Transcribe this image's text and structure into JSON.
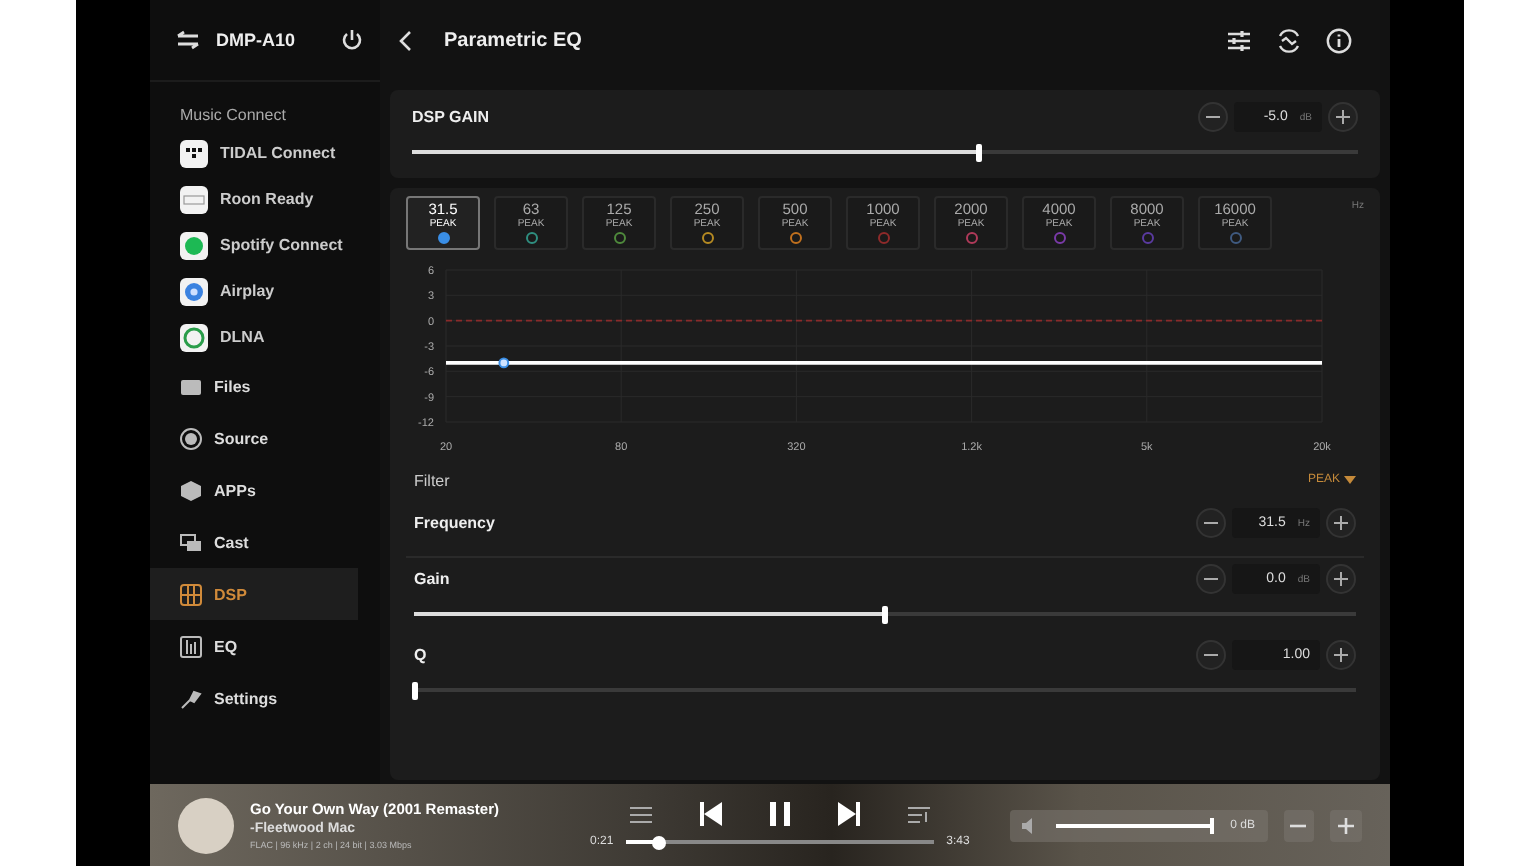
{
  "sidebar": {
    "device": "DMP-A10",
    "section_title": "Music Connect",
    "connect_items": [
      {
        "label": "TIDAL Connect",
        "kind": "tidal"
      },
      {
        "label": "Roon Ready",
        "kind": "roon"
      },
      {
        "label": "Spotify Connect",
        "kind": "spotify"
      },
      {
        "label": "Airplay",
        "kind": "airplay"
      },
      {
        "label": "DLNA",
        "kind": "dlna"
      }
    ],
    "items": [
      {
        "label": "Files",
        "kind": "files",
        "selected": false
      },
      {
        "label": "Source",
        "kind": "source",
        "selected": false
      },
      {
        "label": "APPs",
        "kind": "apps",
        "selected": false
      },
      {
        "label": "Cast",
        "kind": "cast",
        "selected": false
      },
      {
        "label": "DSP",
        "kind": "dsp",
        "selected": true
      },
      {
        "label": "EQ",
        "kind": "eq",
        "selected": false
      },
      {
        "label": "Settings",
        "kind": "settings",
        "selected": false
      }
    ]
  },
  "header": {
    "title": "Parametric EQ"
  },
  "dsp_gain": {
    "label": "DSP GAIN",
    "value": "-5.0",
    "unit": "dB",
    "level": 0.6
  },
  "bands": [
    {
      "freq": "31.5",
      "type": "PEAK",
      "color": "#3a8ee6",
      "selected": true
    },
    {
      "freq": "63",
      "type": "PEAK",
      "color": "#2f8f80",
      "selected": false
    },
    {
      "freq": "125",
      "type": "PEAK",
      "color": "#4f8a3c",
      "selected": false
    },
    {
      "freq": "250",
      "type": "PEAK",
      "color": "#b58a22",
      "selected": false
    },
    {
      "freq": "500",
      "type": "PEAK",
      "color": "#c0701e",
      "selected": false
    },
    {
      "freq": "1000",
      "type": "PEAK",
      "color": "#8e2a2a",
      "selected": false
    },
    {
      "freq": "2000",
      "type": "PEAK",
      "color": "#b03a5a",
      "selected": false
    },
    {
      "freq": "4000",
      "type": "PEAK",
      "color": "#7a3aa8",
      "selected": false
    },
    {
      "freq": "8000",
      "type": "PEAK",
      "color": "#5a3aa0",
      "selected": false
    },
    {
      "freq": "16000",
      "type": "PEAK",
      "color": "#3f5a80",
      "selected": false
    }
  ],
  "bands_unit": "Hz",
  "chart_data": {
    "type": "line",
    "categories": [
      "20",
      "80",
      "320",
      "1.2k",
      "5k",
      "20k"
    ],
    "series": [
      {
        "color": "#ffffff",
        "line_style": "solid",
        "values": [
          -5,
          -5,
          -5,
          -5,
          -5,
          -5
        ]
      },
      {
        "color": "#8a2a2a",
        "line_style": "dashed",
        "values": [
          0,
          0,
          0,
          0,
          0,
          0
        ]
      }
    ],
    "grid": true,
    "ylim": [
      -12,
      6
    ],
    "yticks": [
      6,
      3,
      0,
      -3,
      -6,
      -9,
      -12
    ]
  },
  "filter": {
    "label": "Filter",
    "value": "PEAK"
  },
  "params": [
    {
      "label": "Frequency",
      "value": "31.5",
      "unit": "Hz",
      "kind": "stepper"
    },
    {
      "label": "Gain",
      "value": "0.0",
      "unit": "dB",
      "kind": "slider",
      "level": 0.5
    },
    {
      "label": "Q",
      "value": "1.00",
      "kind": "slider",
      "level": 0.0
    }
  ],
  "player": {
    "title": "Go Your Own Way  (2001 Remaster)",
    "artist": "-Fleetwood Mac",
    "format": "FLAC | 96 kHz | 2 ch | 24 bit | 3.03 Mbps",
    "elapsed": "0:21",
    "total": "3:43",
    "level": 0.11,
    "volume": {
      "value": "0 dB",
      "level": 1.0
    }
  }
}
